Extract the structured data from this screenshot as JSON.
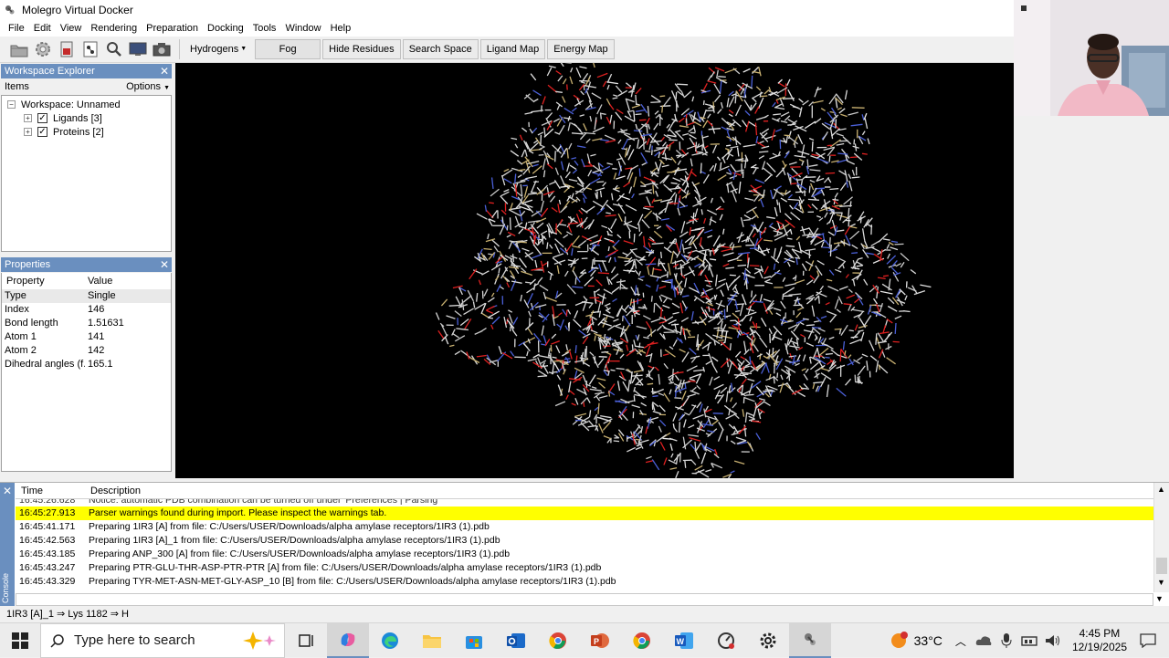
{
  "window": {
    "title": "Molegro Virtual Docker"
  },
  "menu": [
    "File",
    "Edit",
    "View",
    "Rendering",
    "Preparation",
    "Docking",
    "Tools",
    "Window",
    "Help"
  ],
  "toolbar": {
    "icons": [
      "open-folder-icon",
      "settings-gear-icon",
      "clear-workspace-icon",
      "molecule-icon",
      "zoom-magnifier-icon",
      "screenshot-icon",
      "camera-icon"
    ],
    "hydrogens": "Hydrogens",
    "fog": "Fog",
    "hide_residues": "Hide Residues",
    "search_space": "Search Space",
    "ligand_map": "Ligand Map",
    "energy_map": "Energy Map"
  },
  "workspace": {
    "title": "Workspace Explorer",
    "items_label": "Items",
    "options_label": "Options",
    "root": "Workspace: Unnamed",
    "children": [
      {
        "label": "Ligands [3]",
        "checked": true
      },
      {
        "label": "Proteins [2]",
        "checked": true
      }
    ]
  },
  "properties": {
    "title": "Properties",
    "col_property": "Property",
    "col_value": "Value",
    "rows": [
      {
        "k": "Type",
        "v": "Single"
      },
      {
        "k": "Index",
        "v": "146"
      },
      {
        "k": "Bond length",
        "v": "1.51631"
      },
      {
        "k": "Atom 1",
        "v": "141"
      },
      {
        "k": "Atom 2",
        "v": "142"
      },
      {
        "k": "Dihedral angles (f...",
        "v": "165.1"
      }
    ]
  },
  "console": {
    "side_label": "Console",
    "col_time": "Time",
    "col_desc": "Description",
    "partial_row": {
      "t": "16:45:26.628",
      "d": "Notice: automatic PDB combination can be turned off under 'Preferences | Parsing'"
    },
    "rows": [
      {
        "t": "16:45:27.913",
        "d": "Parser warnings found during import. Please inspect the warnings tab.",
        "highlight": true
      },
      {
        "t": "16:45:41.171",
        "d": "Preparing 1IR3 [A] from file: C:/Users/USER/Downloads/alpha amylase receptors/1IR3 (1).pdb"
      },
      {
        "t": "16:45:42.563",
        "d": "Preparing 1IR3 [A]_1 from file: C:/Users/USER/Downloads/alpha amylase receptors/1IR3 (1).pdb"
      },
      {
        "t": "16:45:43.185",
        "d": "Preparing ANP_300 [A] from file: C:/Users/USER/Downloads/alpha amylase receptors/1IR3 (1).pdb"
      },
      {
        "t": "16:45:43.247",
        "d": "Preparing PTR-GLU-THR-ASP-PTR-PTR [A] from file: C:/Users/USER/Downloads/alpha amylase receptors/1IR3 (1).pdb"
      },
      {
        "t": "16:45:43.329",
        "d": "Preparing TYR-MET-ASN-MET-GLY-ASP_10 [B] from file: C:/Users/USER/Downloads/alpha amylase receptors/1IR3 (1).pdb"
      }
    ]
  },
  "status": "1IR3 [A]_1 ⇒ Lys 1182 ⇒ H",
  "taskbar": {
    "search_placeholder": "Type here to search",
    "temperature": "33°C",
    "time": "4:45 PM",
    "date": "12/19/2025",
    "apps": [
      "task-view-icon",
      "copilot-icon",
      "edge-icon",
      "file-explorer-icon",
      "store-icon",
      "outlook-icon",
      "chrome-icon",
      "powerpoint-icon",
      "chrome-profile-icon",
      "word-icon",
      "speed-icon",
      "settings-icon",
      "molegro-icon"
    ]
  },
  "colors": {
    "panel_header": "#6a8fbf",
    "highlight": "#ffff00",
    "viewport_bg": "#000000"
  }
}
